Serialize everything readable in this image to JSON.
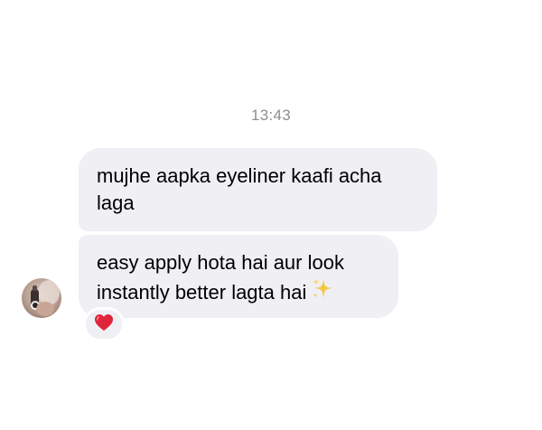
{
  "thread": {
    "timestamp": "13:43",
    "messages": [
      {
        "text": "mujhe aapka eyeliner kaafi acha laga"
      },
      {
        "text": "easy apply hota hai aur look instantly better lagta hai",
        "emoji": "sparkles-icon"
      }
    ],
    "reaction": {
      "icon": "heart-icon",
      "color": "#e0243a"
    }
  },
  "colors": {
    "bubble_bg": "#efeff4",
    "timestamp_text": "#8e8e93"
  }
}
